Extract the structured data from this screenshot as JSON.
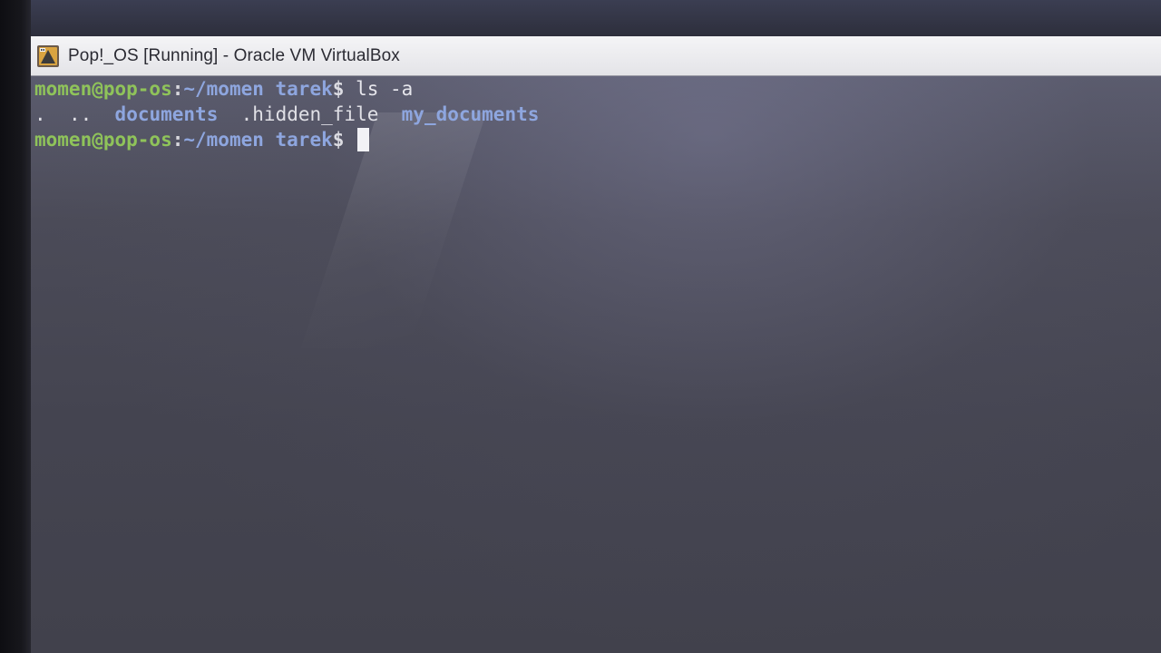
{
  "window": {
    "title": "Pop!_OS [Running] - Oracle VM VirtualBox",
    "icon": "virtualbox-icon"
  },
  "terminal": {
    "lines": [
      {
        "user_host": "momen@pop-os",
        "sep": ":",
        "path": "~/momen tarek",
        "dollar": "$",
        "command": "ls -a"
      },
      {
        "output": [
          ".",
          "..",
          "documents",
          ".hidden_file",
          "my_documents"
        ]
      },
      {
        "user_host": "momen@pop-os",
        "sep": ":",
        "path": "~/momen tarek",
        "dollar": "$",
        "command": ""
      }
    ]
  },
  "colors": {
    "user_host": "#8fc35a",
    "path": "#8ea6df",
    "directory": "#8ea6df",
    "text": "#e6e6ec",
    "cursor": "#f2f2f6"
  }
}
